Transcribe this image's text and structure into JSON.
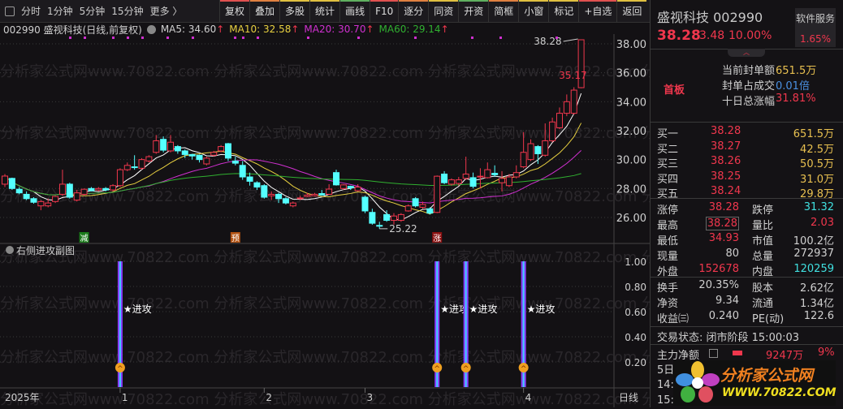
{
  "toolbar": {
    "periods": [
      "分时",
      "1分钟",
      "5分钟",
      "15分钟",
      "更多 〉"
    ],
    "buttons": [
      {
        "label": "复权",
        "color": "#e05050"
      },
      {
        "label": "叠加",
        "color": "#e08040"
      },
      {
        "label": "多股",
        "color": "#e0c040"
      },
      {
        "label": "统计",
        "color": "#e0c040"
      },
      {
        "label": "画线",
        "color": "#60b060"
      },
      {
        "label": "F10",
        "color": "#e05050"
      },
      {
        "label": "逐分",
        "color": "#e08040"
      },
      {
        "label": "同资",
        "color": "#e0c040"
      },
      {
        "label": "开资",
        "color": "#60b060"
      },
      {
        "label": "简框",
        "color": "#e08040"
      },
      {
        "label": "小窗",
        "color": "#e0c040"
      },
      {
        "label": "标记",
        "color": "#e0c040"
      },
      {
        "label": "+自选",
        "color": "#e05050"
      },
      {
        "label": "返回",
        "color": "#e0c040"
      }
    ]
  },
  "infobar": {
    "title": "002990 盛视科技(日线,前复权)",
    "ma5": "MA5: 34.60",
    "ma10": "MA10: 32.58",
    "ma20": "MA20: 30.70",
    "ma60": "MA60: 29.14",
    "up_arrow": "↑"
  },
  "watermark": "分析家公式网www.70822.com ",
  "colors": {
    "up": "#f0374d",
    "down": "#54ffff",
    "ma5": "#ffffff",
    "ma10": "#e8d040",
    "ma20": "#d030d0",
    "ma60": "#30b030",
    "signal": "#8a3cff"
  },
  "chart_data": {
    "type": "candlestick",
    "ylim": [
      25,
      38.5
    ],
    "yticks": [
      "38.00",
      "36.00",
      "34.00",
      "32.00",
      "30.00",
      "28.00",
      "26.00"
    ],
    "ytick_values": [
      38,
      36,
      34,
      32,
      30,
      28,
      26
    ],
    "ohlc": [
      [
        28.3,
        29.0,
        28.1,
        28.86
      ],
      [
        28.7,
        28.75,
        27.9,
        28.0
      ],
      [
        27.95,
        28.1,
        27.6,
        27.7
      ],
      [
        27.6,
        27.8,
        27.2,
        27.3
      ],
      [
        27.3,
        27.4,
        26.95,
        27.05
      ],
      [
        26.8,
        27.2,
        26.5,
        27.1
      ],
      [
        26.8,
        27.3,
        26.7,
        27.0
      ],
      [
        27.1,
        27.5,
        27.0,
        27.45
      ],
      [
        27.6,
        29.3,
        27.5,
        28.3
      ],
      [
        28.3,
        28.4,
        27.3,
        27.4
      ],
      [
        27.2,
        27.9,
        27.1,
        27.7
      ],
      [
        27.6,
        28.0,
        27.5,
        27.95
      ],
      [
        28.0,
        28.1,
        27.8,
        27.85
      ],
      [
        27.9,
        28.1,
        27.8,
        28.0
      ],
      [
        28.0,
        28.1,
        27.8,
        27.9
      ],
      [
        27.9,
        28.3,
        27.8,
        28.2
      ],
      [
        28.2,
        29.4,
        28.1,
        29.3
      ],
      [
        29.3,
        29.8,
        29.2,
        29.6
      ],
      [
        29.5,
        30.3,
        29.3,
        29.45
      ],
      [
        29.4,
        30.1,
        29.3,
        30.0
      ],
      [
        29.9,
        30.3,
        29.8,
        30.2
      ],
      [
        30.5,
        31.7,
        30.4,
        31.3
      ],
      [
        31.4,
        31.6,
        30.5,
        30.65
      ],
      [
        30.6,
        31.7,
        30.5,
        31.2
      ],
      [
        30.9,
        31.0,
        30.4,
        30.6
      ],
      [
        30.6,
        30.7,
        30.1,
        30.35
      ],
      [
        30.35,
        30.4,
        30.0,
        30.25
      ],
      [
        30.3,
        30.35,
        29.8,
        30.0
      ],
      [
        29.7,
        30.2,
        29.6,
        30.1
      ],
      [
        30.3,
        30.6,
        30.2,
        30.5
      ],
      [
        30.6,
        31.0,
        30.5,
        30.9
      ],
      [
        31.1,
        31.15,
        29.9,
        30.1
      ],
      [
        29.9,
        30.2,
        29.6,
        29.75
      ],
      [
        29.6,
        29.9,
        28.6,
        28.8
      ],
      [
        28.8,
        29.1,
        28.2,
        28.5
      ],
      [
        28.4,
        28.5,
        27.9,
        28.1
      ],
      [
        28.2,
        28.3,
        27.3,
        27.4
      ],
      [
        27.5,
        27.8,
        27.2,
        27.6
      ],
      [
        27.6,
        27.7,
        27.0,
        27.3
      ],
      [
        27.3,
        27.4,
        26.9,
        27.0
      ],
      [
        26.8,
        27.1,
        26.7,
        27.0
      ],
      [
        27.3,
        27.5,
        27.2,
        27.35
      ],
      [
        27.45,
        27.7,
        27.4,
        27.55
      ],
      [
        27.5,
        27.7,
        27.45,
        27.6
      ],
      [
        27.65,
        27.9,
        27.5,
        27.55
      ],
      [
        27.6,
        28.3,
        27.55,
        27.96
      ],
      [
        29.1,
        29.3,
        28.2,
        28.25
      ],
      [
        28.0,
        28.3,
        27.9,
        28.25
      ],
      [
        28.15,
        28.2,
        27.9,
        28.05
      ],
      [
        27.85,
        28.3,
        27.8,
        28.1
      ],
      [
        27.4,
        27.5,
        26.3,
        26.45
      ],
      [
        26.35,
        26.6,
        25.5,
        25.6
      ],
      [
        25.45,
        25.7,
        25.22,
        25.4
      ],
      [
        26.2,
        26.5,
        25.7,
        25.8
      ],
      [
        25.8,
        26.3,
        25.5,
        26.1
      ],
      [
        25.8,
        26.3,
        25.7,
        26.2
      ],
      [
        26.45,
        26.9,
        26.4,
        26.8
      ],
      [
        27.3,
        27.4,
        26.7,
        26.8
      ],
      [
        26.7,
        27.1,
        26.6,
        26.9
      ],
      [
        26.6,
        26.7,
        26.2,
        26.3
      ],
      [
        26.35,
        28.9,
        26.3,
        28.85
      ],
      [
        29.0,
        29.2,
        28.3,
        28.4
      ],
      [
        28.3,
        28.7,
        28.2,
        28.6
      ],
      [
        28.35,
        28.8,
        28.2,
        28.6
      ],
      [
        28.7,
        30.2,
        28.6,
        29.0
      ],
      [
        28.75,
        29.1,
        28.0,
        28.15
      ],
      [
        28.8,
        29.4,
        28.0,
        28.85
      ],
      [
        28.75,
        29.8,
        28.7,
        29.3
      ],
      [
        29.05,
        29.6,
        28.8,
        28.95
      ],
      [
        28.4,
        29.2,
        27.8,
        28.7
      ],
      [
        28.2,
        29.0,
        28.1,
        28.8
      ],
      [
        28.8,
        29.6,
        28.7,
        29.1
      ],
      [
        29.5,
        31.9,
        29.4,
        30.5
      ],
      [
        30.0,
        31.4,
        29.9,
        31.1
      ],
      [
        30.9,
        31.0,
        29.7,
        30.4
      ],
      [
        30.3,
        32.5,
        30.2,
        31.3
      ],
      [
        31.3,
        32.9,
        31.2,
        32.6
      ],
      [
        32.2,
        33.6,
        32.1,
        33.2
      ],
      [
        33.2,
        34.5,
        33.0,
        34.0
      ],
      [
        33.2,
        35.0,
        33.1,
        34.8
      ],
      [
        34.97,
        38.28,
        34.93,
        38.28
      ]
    ],
    "annotations": {
      "high_label": "38.28",
      "low_label": "25.22",
      "prev_label": "35.17",
      "low_index": 52,
      "high_index": 80
    },
    "markers": [
      {
        "index": 11,
        "text": "减",
        "color": "#1a7a1a"
      },
      {
        "index": 32,
        "text": "预",
        "color": "#b05010"
      },
      {
        "index": 60,
        "text": "涨",
        "color": "#8a1010"
      }
    ],
    "sub": {
      "title": "右侧进攻副图",
      "yticks": [
        "1.00",
        "0.80",
        "0.60",
        "0.40",
        "0.20"
      ],
      "ytick_values": [
        1,
        0.8,
        0.6,
        0.4,
        0.2
      ],
      "signal_indices": [
        16,
        60,
        64,
        72
      ],
      "signal_label": "★进攻"
    },
    "xaxis": {
      "year": "2025年",
      "months": [
        {
          "label": "1",
          "index": 16
        },
        {
          "label": "2",
          "index": 36
        },
        {
          "label": "3",
          "index": 50
        },
        {
          "label": "4",
          "index": 72
        }
      ],
      "period": "日线"
    }
  },
  "quote": {
    "name": "盛视科技",
    "code": "002990",
    "price": "38.28",
    "change": "3.48",
    "pct": "10.00%",
    "sector": "软件服务",
    "sector_pct": "1.65%",
    "board": "首板",
    "seal": [
      {
        "label": "当前封单额",
        "value": "651.5万",
        "cls": "yel"
      },
      {
        "label": "封单占成交",
        "value": "0.01倍",
        "cls": "blue"
      },
      {
        "label": "十日总涨幅",
        "value": "31.81%",
        "cls": "red"
      }
    ],
    "bids": [
      {
        "label": "买一",
        "price": "38.28",
        "vol": "651.5万"
      },
      {
        "label": "买二",
        "price": "38.27",
        "vol": "42.5万"
      },
      {
        "label": "买三",
        "price": "38.26",
        "vol": "50.5万"
      },
      {
        "label": "买四",
        "price": "38.25",
        "vol": "31.0万"
      },
      {
        "label": "买五",
        "price": "38.24",
        "vol": "29.8万"
      }
    ],
    "stats": [
      [
        {
          "l": "涨停",
          "v": "38.28",
          "c": "red"
        },
        {
          "l": "跌停",
          "v": "31.32",
          "c": "cy"
        }
      ],
      [
        {
          "l": "最高",
          "v": "38.28",
          "c": "red"
        },
        {
          "l": "量比",
          "v": "2.03",
          "c": "red"
        }
      ],
      [
        {
          "l": "最低",
          "v": "34.93",
          "c": "red"
        },
        {
          "l": "市值",
          "v": "100.2亿",
          "c": "wh"
        }
      ],
      [
        {
          "l": "现量",
          "v": "80",
          "c": "wh"
        },
        {
          "l": "总量",
          "v": "272937",
          "c": "wh"
        }
      ],
      [
        {
          "l": "外盘",
          "v": "152678",
          "c": "red"
        },
        {
          "l": "内盘",
          "v": "120259",
          "c": "cy"
        }
      ]
    ],
    "fin": [
      [
        {
          "l": "换手",
          "v": "20.35%"
        },
        {
          "l": "股本",
          "v": "2.62亿"
        }
      ],
      [
        {
          "l": "净资",
          "v": "9.34"
        },
        {
          "l": "流通",
          "v": "1.34亿"
        }
      ],
      [
        {
          "l": "收益㈢",
          "v": "0.240"
        },
        {
          "l": "PE(动)",
          "v": "122.6"
        }
      ]
    ],
    "status": "交易状态: 闭市阶段 15:00:03",
    "flow_label": "主力净额",
    "flow_value": "9247万",
    "flow_pct": "9%",
    "day5": "5日",
    "t1": "14:",
    "t2": "15:",
    "logo_cn": "分析家公式网",
    "logo_url": "WWW.70822.COM"
  }
}
